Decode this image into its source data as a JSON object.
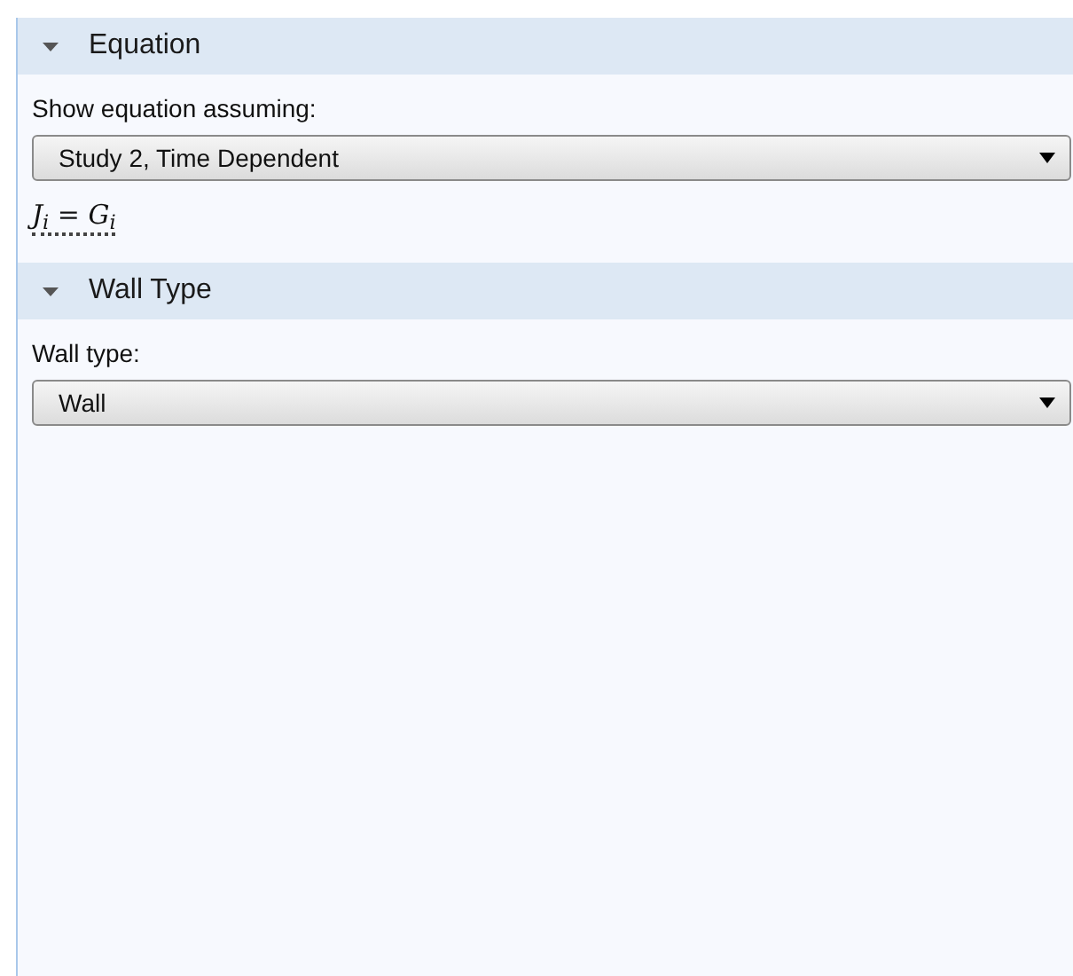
{
  "sections": [
    {
      "title": "Equation",
      "expanded": true,
      "label": "Show equation assuming:",
      "select": "Study 2, Time Dependent",
      "equation": "J$_{i}$ = G$_{i}$"
    },
    {
      "title": "Wall Type",
      "expanded": true,
      "label": "Wall type:",
      "select": "Wall"
    }
  ]
}
